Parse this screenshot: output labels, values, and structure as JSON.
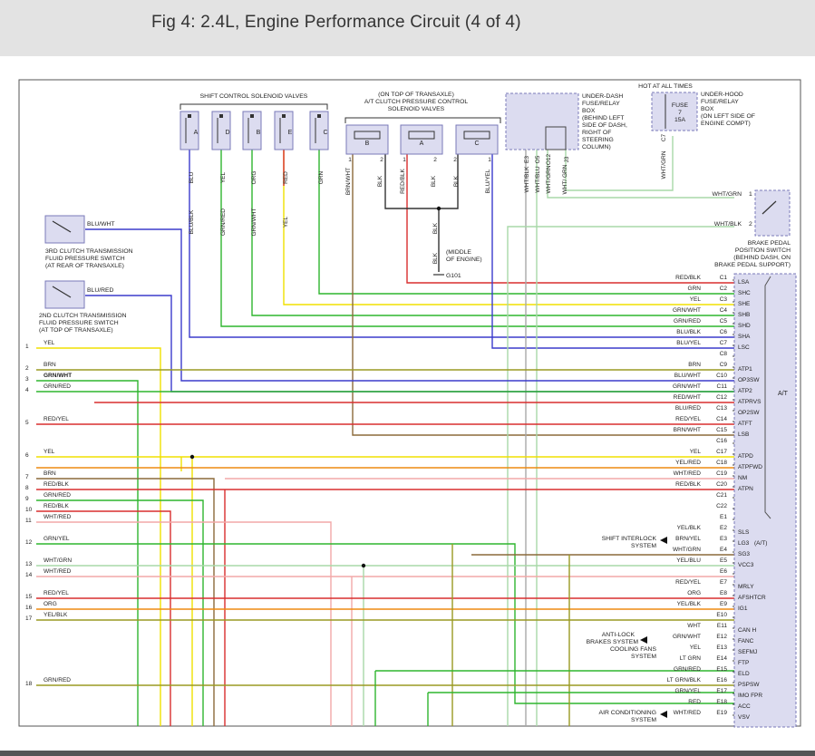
{
  "page": {
    "title": "Fig 4: 2.4L, Engine Performance Circuit (4 of 4)"
  },
  "labels": {
    "shift_solenoids": "SHIFT CONTROL SOLENOID VALVES",
    "ac_valves": [
      "(ON TOP OF TRANSAXLE)",
      "A/T CLUTCH PRESSURE CONTROL",
      "SOLENOID VALVES"
    ],
    "under_dash": [
      "UNDER-DASH",
      "FUSE/RELAY",
      "BOX",
      "(BEHIND LEFT",
      "SIDE OF DASH,",
      "RIGHT OF",
      "STEERING",
      "COLUMN)"
    ],
    "hot_at_all_times": "HOT AT ALL TIMES",
    "fuse": [
      "FUSE",
      "7",
      "15A"
    ],
    "under_hood": [
      "UNDER-HOOD",
      "FUSE/RELAY",
      "BOX",
      "(ON LEFT SIDE OF",
      "ENGINE COMPT)"
    ],
    "fuse_pin": "C7",
    "fuse_wire": "WHT/GRN",
    "brake_switch": [
      "BRAKE PEDAL",
      "POSITION SWITCH",
      "(BEHIND DASH, ON",
      "BRAKE PEDAL SUPPORT)"
    ],
    "brake_wires": [
      "WHT/GRN",
      "WHT/BLK"
    ],
    "brake_pins": [
      "1",
      "2"
    ],
    "third_clutch": [
      "3RD CLUTCH TRANSMISSION",
      "FLUID PRESSURE SWITCH",
      "(AT REAR OF TRANSAXLE)"
    ],
    "second_clutch": [
      "2ND CLUTCH TRANSMISSION",
      "FLUID PRESSURE SWITCH",
      "(AT TOP OF TRANSAXLE)"
    ],
    "sw3_wire": "BLU/WHT",
    "sw2_wire": "BLU/RED",
    "ground_note": [
      "(MIDDLE",
      "OF ENGINE)"
    ],
    "ground_id": "G101",
    "ground_wire": "BLK",
    "ecm_name": "A/T",
    "shift_interlock": [
      "SHIFT INTERLOCK",
      "SYSTEM"
    ],
    "abs": [
      "ANTI-LOCK",
      "BRAKES SYSTEM"
    ],
    "cooling": [
      "COOLING FANS",
      "SYSTEM"
    ],
    "aircon": [
      "AIR CONDITIONING",
      "SYSTEM"
    ],
    "solenoid_letters": [
      "A",
      "D",
      "B",
      "E",
      "C"
    ],
    "ac_letters": [
      "B",
      "A",
      "C"
    ],
    "pin_1": "1",
    "pin_2": "2",
    "solenoid_wires_upper": [
      "BLU",
      "YEL",
      "ORG",
      "RED",
      "GRN"
    ],
    "solenoid_wires_lower": [
      "BLU/BLK",
      "GRN/RED",
      "GRN/WHT",
      "YEL"
    ],
    "ac_wires": [
      "BRN/WHT",
      "BLK",
      "RED/BLK",
      "BLK",
      "BLK",
      "BLU/YEL"
    ],
    "under_dash_wires": [
      "WHT/BLK",
      "WHT/BLU",
      "WHT/GRN",
      "WHT/ GRN"
    ],
    "under_dash_pins": [
      "E3",
      "O5",
      "O12",
      "J3"
    ],
    "blk_mid": "BLK"
  },
  "connections": {
    "left": [
      {
        "num": "1",
        "wire": "YEL"
      },
      {
        "num": "2",
        "wire": "BRN"
      },
      {
        "num": "3",
        "wire": "GRN/WHT"
      },
      {
        "num": "4",
        "wire": "GRN/RED"
      },
      {
        "num": "5",
        "wire": "RED/YEL"
      },
      {
        "num": "6",
        "wire": "YEL"
      },
      {
        "num": "7",
        "wire": "BRN"
      },
      {
        "num": "8",
        "wire": "RED/BLK"
      },
      {
        "num": "9",
        "wire": "GRN/RED"
      },
      {
        "num": "10",
        "wire": "RED/BLK"
      },
      {
        "num": "11",
        "wire": "WHT/RED"
      },
      {
        "num": "12",
        "wire": "GRN/YEL"
      },
      {
        "num": "13",
        "wire": "WHT/GRN"
      },
      {
        "num": "14",
        "wire": "WHT/RED"
      },
      {
        "num": "15",
        "wire": "RED/YEL"
      },
      {
        "num": "16",
        "wire": "ORG"
      },
      {
        "num": "17",
        "wire": "YEL/BLK"
      },
      {
        "num": "18",
        "wire": "GRN/RED"
      }
    ],
    "right": [
      {
        "pin": "C1",
        "wire": "RED/BLK",
        "sig": "LSA"
      },
      {
        "pin": "C2",
        "wire": "GRN",
        "sig": "SHC"
      },
      {
        "pin": "C3",
        "wire": "YEL",
        "sig": "SHE"
      },
      {
        "pin": "C4",
        "wire": "GRN/WHT",
        "sig": "SHB"
      },
      {
        "pin": "C5",
        "wire": "GRN/RED",
        "sig": "SHD"
      },
      {
        "pin": "C6",
        "wire": "BLU/BLK",
        "sig": "SHA"
      },
      {
        "pin": "C7",
        "wire": "BLU/YEL",
        "sig": "LSC"
      },
      {
        "pin": "C8",
        "wire": "",
        "sig": ""
      },
      {
        "pin": "C9",
        "wire": "BRN",
        "sig": "ATP1"
      },
      {
        "pin": "C10",
        "wire": "BLU/WHT",
        "sig": "OP3SW"
      },
      {
        "pin": "C11",
        "wire": "GRN/WHT",
        "sig": "ATP2"
      },
      {
        "pin": "C12",
        "wire": "RED/WHT",
        "sig": "ATPRVS"
      },
      {
        "pin": "C13",
        "wire": "BLU/RED",
        "sig": "OP2SW"
      },
      {
        "pin": "C14",
        "wire": "RED/YEL",
        "sig": "ATFT"
      },
      {
        "pin": "C15",
        "wire": "BRN/WHT",
        "sig": "LSB"
      },
      {
        "pin": "C16",
        "wire": "",
        "sig": ""
      },
      {
        "pin": "C17",
        "wire": "YEL",
        "sig": "ATPD"
      },
      {
        "pin": "C18",
        "wire": "YEL/RED",
        "sig": "ATPFWD"
      },
      {
        "pin": "C19",
        "wire": "WHT/RED",
        "sig": "NM"
      },
      {
        "pin": "C20",
        "wire": "RED/BLK",
        "sig": "ATPN"
      },
      {
        "pin": "C21",
        "wire": "",
        "sig": ""
      },
      {
        "pin": "C22",
        "wire": "",
        "sig": ""
      },
      {
        "pin": "E1",
        "wire": "",
        "sig": ""
      },
      {
        "pin": "E2",
        "wire": "YEL/BLK",
        "sig": "SLS"
      },
      {
        "pin": "E3",
        "wire": "BRN/YEL",
        "sig": "LG3"
      },
      {
        "pin": "E4",
        "wire": "WHT/GRN",
        "sig": "SG3"
      },
      {
        "pin": "E5",
        "wire": "YEL/BLU",
        "sig": "VCC3"
      },
      {
        "pin": "E6",
        "wire": "",
        "sig": ""
      },
      {
        "pin": "E7",
        "wire": "RED/YEL",
        "sig": "MRLY"
      },
      {
        "pin": "E8",
        "wire": "ORG",
        "sig": "AFSHTCR"
      },
      {
        "pin": "E9",
        "wire": "YEL/BLK",
        "sig": "IG1"
      },
      {
        "pin": "E10",
        "wire": "",
        "sig": ""
      },
      {
        "pin": "E11",
        "wire": "WHT",
        "sig": "CAN H"
      },
      {
        "pin": "E12",
        "wire": "GRN/WHT",
        "sig": "FANC"
      },
      {
        "pin": "E13",
        "wire": "YEL",
        "sig": "SEFMJ"
      },
      {
        "pin": "E14",
        "wire": "LT GRN",
        "sig": "FTP"
      },
      {
        "pin": "E15",
        "wire": "GRN/RED",
        "sig": "ELD"
      },
      {
        "pin": "E16",
        "wire": "LT GRN/BLK",
        "sig": "PSPSW"
      },
      {
        "pin": "E17",
        "wire": "GRN/YEL",
        "sig": "IMO FPR"
      },
      {
        "pin": "E18",
        "wire": "RED",
        "sig": "ACC"
      },
      {
        "pin": "E19",
        "wire": "WHT/RED",
        "sig": "VSV"
      }
    ],
    "sls_suffix": "(A/T)"
  },
  "colors": {
    "yellow": "#f0e000",
    "brown": "#8b6a3a",
    "green": "#2fb52f",
    "red": "#d92e2e",
    "blue": "#3b3bcc",
    "orange": "#ee8a10",
    "pink": "#f2a8a8",
    "ltgreen": "#a8d8a8",
    "grey": "#a8a8a8",
    "olive": "#9a9a22",
    "box": "#dcdcf0",
    "boxline": "#7a7ab8"
  }
}
